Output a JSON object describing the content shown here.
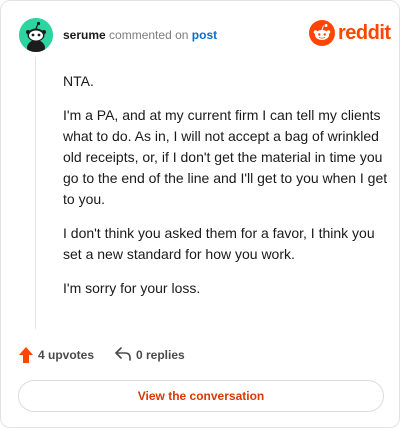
{
  "header": {
    "username": "serume",
    "action_text": "commented on",
    "post_link": "post",
    "brand": "reddit",
    "brand_color": "#ff4500",
    "avatar_color": "#2dd4a0"
  },
  "comment": {
    "paragraphs": [
      "NTA.",
      "I'm a PA, and at my current firm I can tell my clients what to do. As in, I will not accept a bag of wrinkled old receipts, or, if I don't get the material in time you go to the end of the line and I'll get to you when I get to you.",
      "I don't think you asked them for a favor, I think you set a new standard for how you work.",
      "I'm sorry for your loss."
    ]
  },
  "actions": {
    "upvotes_label": "4 upvotes",
    "replies_label": "0 replies",
    "upvote_icon": "upvote-arrow-icon",
    "reply_icon": "reply-arrow-icon"
  },
  "cta": {
    "label": "View the conversation"
  }
}
